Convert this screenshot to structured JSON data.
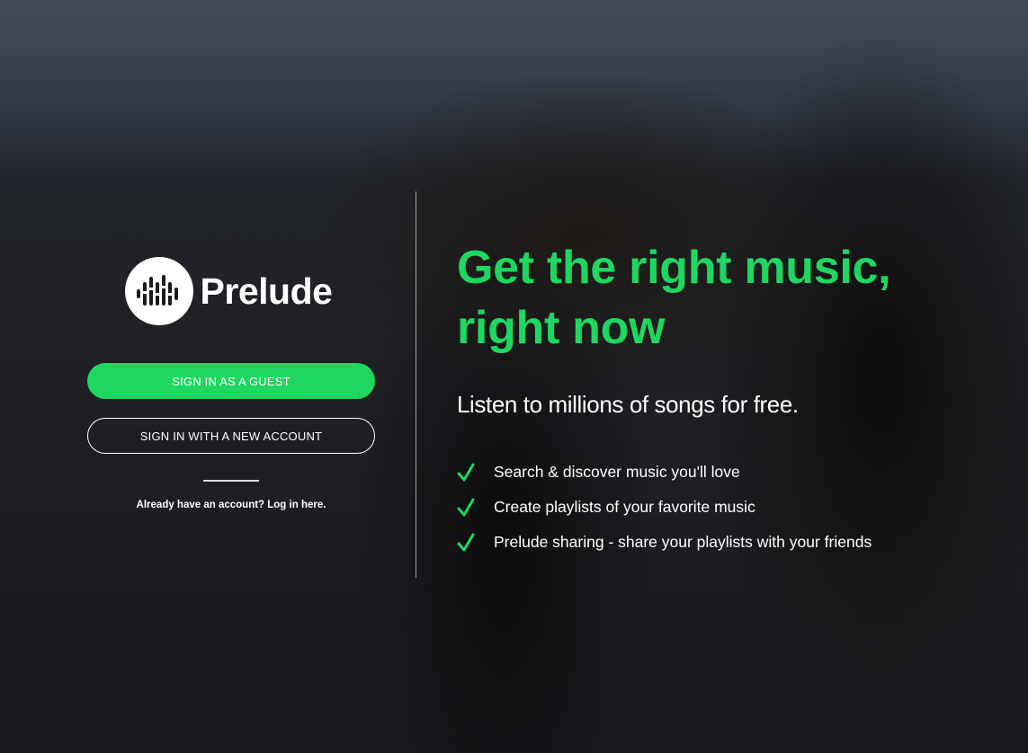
{
  "brand": {
    "name": "Prelude"
  },
  "auth": {
    "guest_label": "SIGN IN AS A GUEST",
    "new_account_label": "SIGN IN WITH A NEW ACCOUNT",
    "login_prompt": "Already have an account? Log in here."
  },
  "hero": {
    "headline_line1": "Get the right music,",
    "headline_line2": "right now",
    "subheadline": "Listen to millions of songs for free."
  },
  "features": [
    {
      "label": "Search & discover music you'll love",
      "icon": "check-icon"
    },
    {
      "label": "Create playlists of your favorite music",
      "icon": "check-icon"
    },
    {
      "label": "Prelude sharing - share your playlists with your friends",
      "icon": "check-icon"
    }
  ],
  "colors": {
    "accent": "#1ed760",
    "text": "#ffffff"
  }
}
